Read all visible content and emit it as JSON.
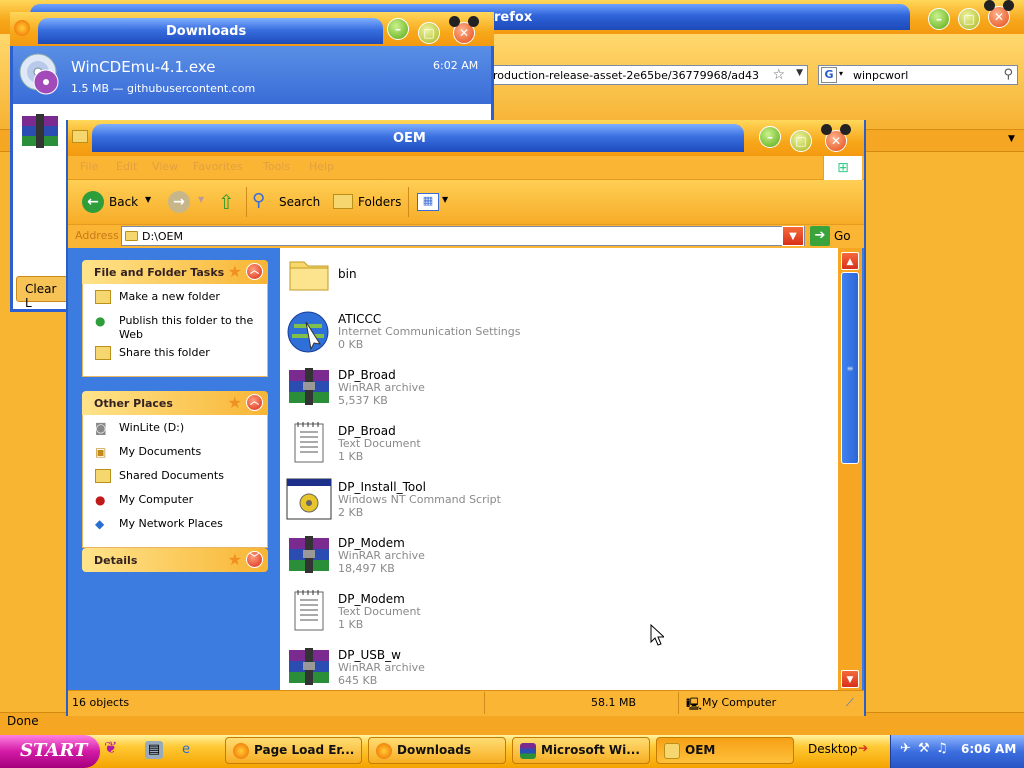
{
  "firefox": {
    "title_partial": "refox",
    "url_partial": "roduction-release-asset-2e65be/36779968/ad43",
    "search_value": "winpcworl",
    "status": "Done"
  },
  "downloads": {
    "title": "Downloads",
    "item": {
      "name": "WinCDEmu-4.1.exe",
      "meta": "1.5 MB — githubusercontent.com",
      "time": "6:02 AM"
    },
    "clear_label": "Clear L"
  },
  "explorer": {
    "title": "OEM",
    "menu": [
      "File",
      "Edit",
      "View",
      "Favorites",
      "Tools",
      "Help"
    ],
    "toolbar": {
      "back": "Back",
      "search": "Search",
      "folders": "Folders"
    },
    "address_label": "Address",
    "address_value": "D:\\OEM",
    "go_label": "Go",
    "panels": {
      "file_tasks": {
        "title": "File and Folder Tasks",
        "items": [
          "Make a new folder",
          "Publish this folder to the Web",
          "Share this folder"
        ]
      },
      "other_places": {
        "title": "Other Places",
        "items": [
          "WinLite (D:)",
          "My Documents",
          "Shared Documents",
          "My Computer",
          "My Network Places"
        ]
      },
      "details": {
        "title": "Details"
      }
    },
    "files": [
      {
        "name": "bin",
        "type": "",
        "size": "",
        "icon": "folder-icon"
      },
      {
        "name": "ATICCC",
        "type": "Internet Communication Settings",
        "size": "0 KB",
        "icon": "internet-settings-icon"
      },
      {
        "name": "DP_Broad",
        "type": "WinRAR archive",
        "size": "5,537 KB",
        "icon": "winrar-icon"
      },
      {
        "name": "DP_Broad",
        "type": "Text Document",
        "size": "1 KB",
        "icon": "text-document-icon"
      },
      {
        "name": "DP_Install_Tool",
        "type": "Windows NT Command Script",
        "size": "2 KB",
        "icon": "command-script-icon"
      },
      {
        "name": "DP_Modem",
        "type": "WinRAR archive",
        "size": "18,497 KB",
        "icon": "winrar-icon"
      },
      {
        "name": "DP_Modem",
        "type": "Text Document",
        "size": "1 KB",
        "icon": "text-document-icon"
      },
      {
        "name": "DP_USB_w",
        "type": "WinRAR archive",
        "size": "645 KB",
        "icon": "winrar-icon"
      }
    ],
    "status": {
      "count": "16 objects",
      "size": "58.1 MB",
      "zone": "My Computer"
    }
  },
  "taskbar": {
    "start": "START",
    "tasks": [
      "Page Load Er...",
      "Downloads",
      "Microsoft Wi...",
      "OEM"
    ],
    "desktop": "Desktop",
    "clock": "6:06 AM"
  },
  "colors": {
    "orange_theme": "#f7b531",
    "blue_theme": "#3c7be0",
    "start_button": "#d21aa6",
    "close_red": "#e24a15"
  }
}
